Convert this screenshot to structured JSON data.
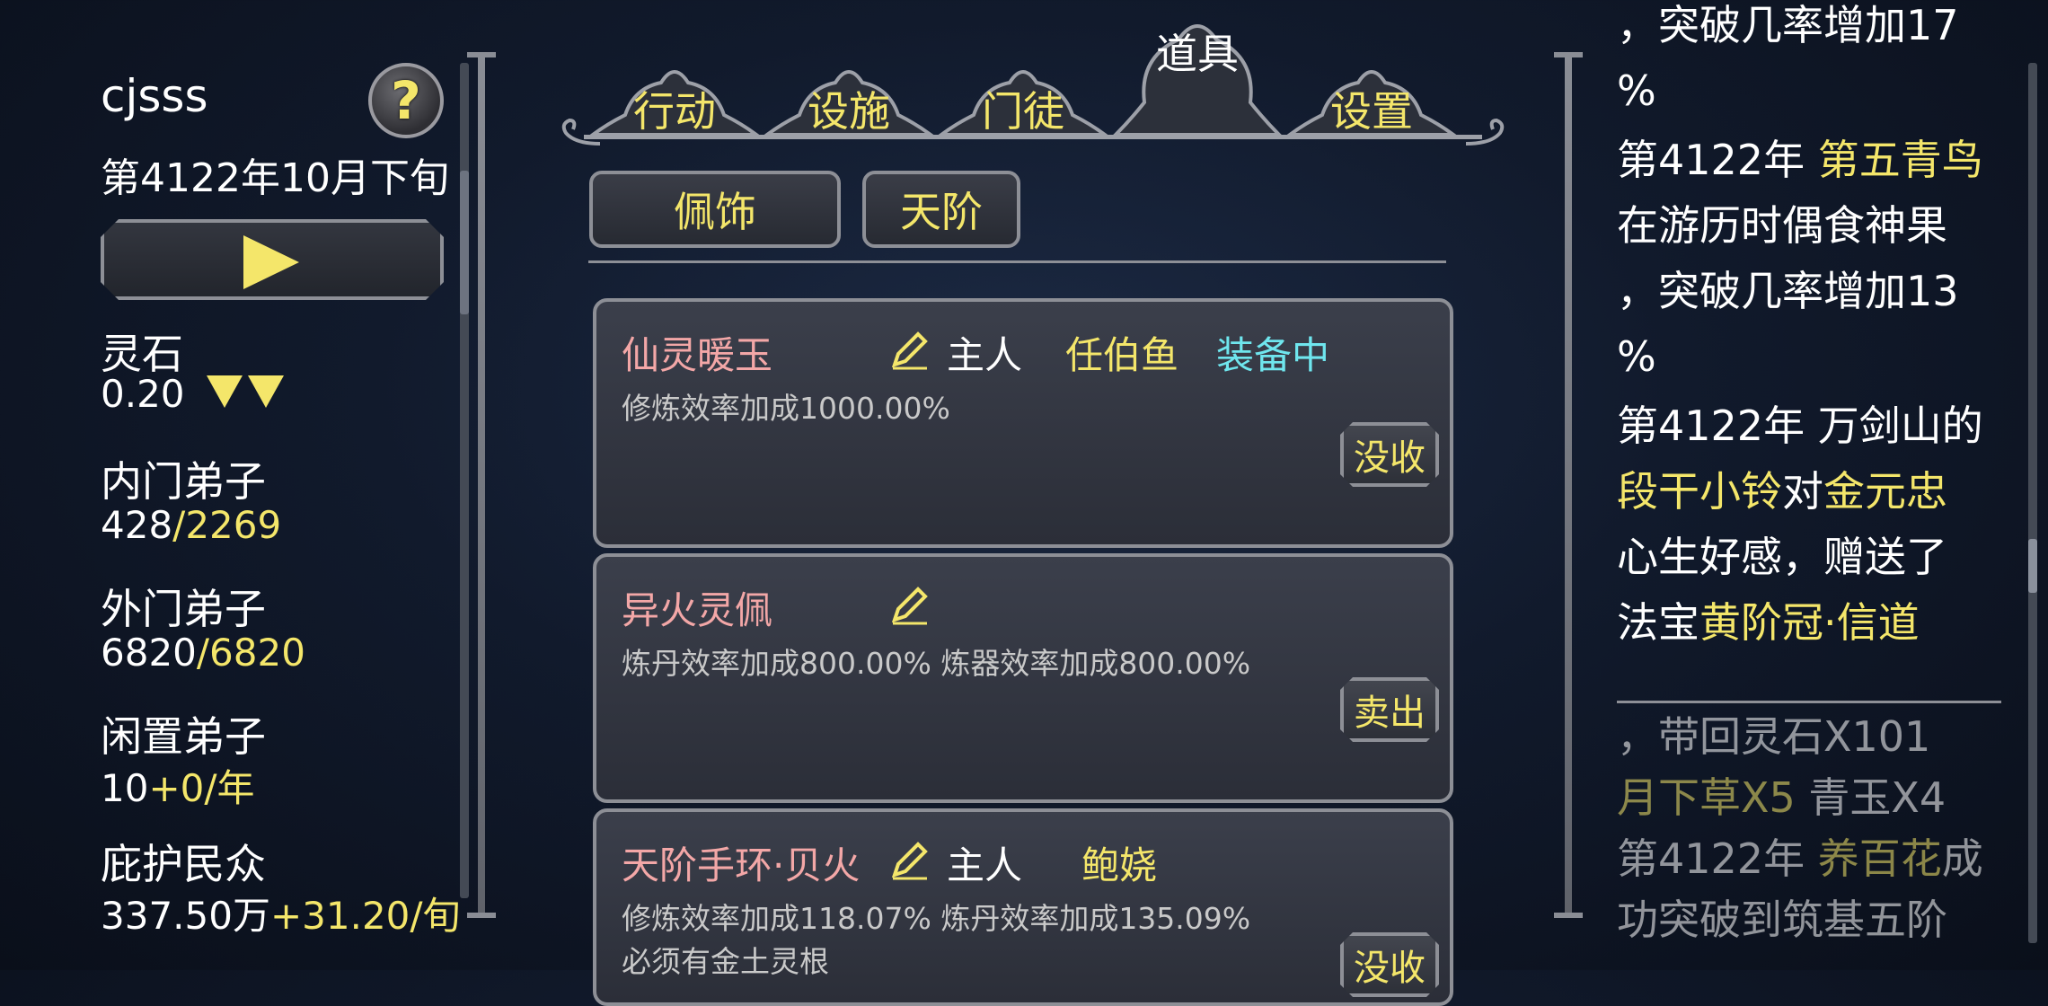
{
  "player": {
    "name": "cjsss",
    "date": "第4122年10月下旬",
    "help_symbol": "?"
  },
  "resources": {
    "spirit_stone": {
      "label": "灵石",
      "value": "0.20"
    },
    "inner_disciples": {
      "label": "内门弟子",
      "current": "428",
      "max": "/2269"
    },
    "outer_disciples": {
      "label": "外门弟子",
      "current": "6820",
      "max": "/6820"
    },
    "idle_disciples": {
      "label": "闲置弟子",
      "current": "10",
      "rate": "+0/年"
    },
    "protected_people": {
      "label": "庇护民众",
      "current": "337.50万",
      "rate": "+31.20/旬"
    }
  },
  "tabs": [
    {
      "label": "行动",
      "active": false
    },
    {
      "label": "设施",
      "active": false
    },
    {
      "label": "门徒",
      "active": false
    },
    {
      "label": "道具",
      "active": true
    },
    {
      "label": "设置",
      "active": false
    }
  ],
  "sub_tabs": [
    {
      "label": "佩饰"
    },
    {
      "label": "天阶"
    }
  ],
  "items": [
    {
      "name": "仙灵暖玉",
      "owner_label": "主人",
      "owner": "任伯鱼",
      "status": "装备中",
      "effects": [
        "修炼效率加成1000.00%"
      ],
      "action": "没收"
    },
    {
      "name": "异火灵佩",
      "owner_label": "",
      "owner": "",
      "status": "",
      "effects": [
        "炼丹效率加成800.00% 炼器效率加成800.00%"
      ],
      "action": "卖出"
    },
    {
      "name": "天阶手环·贝火",
      "owner_label": "主人",
      "owner": "鲍娆",
      "status": "",
      "effects": [
        "修炼效率加成118.07% 炼丹效率加成135.09%",
        "必须有金土灵根"
      ],
      "action": "没收"
    }
  ],
  "log": {
    "l1": "，突破几率增加17",
    "l2": "%",
    "l3_year": "第4122年 ",
    "l3_name": "第五青鸟",
    "l4": "在游历时偶食神果",
    "l5": "，突破几率增加13",
    "l6": "%",
    "l7": "第4122年 万剑山的",
    "l8_name": "段干小铃",
    "l8_mid": "对",
    "l8_name2": "金元忠",
    "l9": "心生好感，赠送了",
    "l10_pre": "法宝",
    "l10_item": "黄阶冠·信道",
    "l11": "，带回灵石X101",
    "l12_a": "月下草X5",
    "l12_b": " 青玉X4",
    "l13_year": "第4122年 ",
    "l13_name": "养百花",
    "l13_post": "成",
    "l14": "功突破到筑基五阶"
  }
}
